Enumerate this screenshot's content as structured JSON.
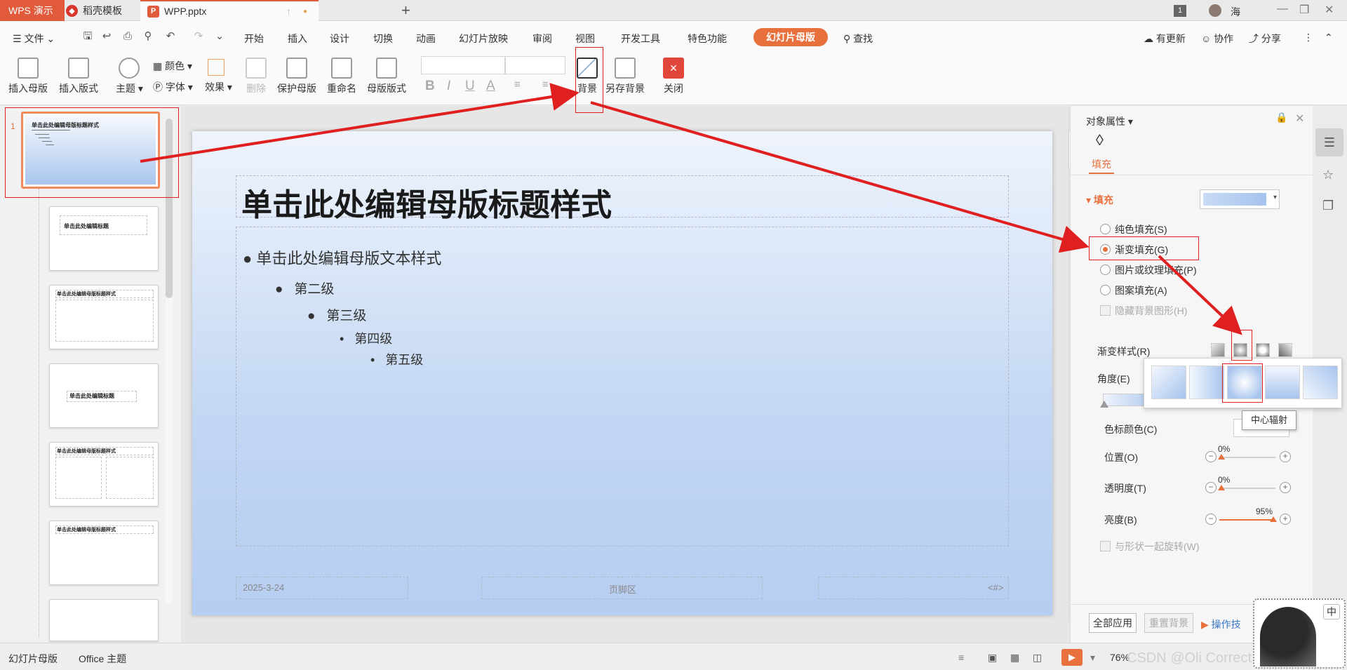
{
  "titlebar": {
    "app_name": "WPS 演示",
    "tabs": [
      {
        "label": "稻壳模板",
        "icon": "daoke-logo-icon"
      },
      {
        "label": "WPP.pptx",
        "icon": "pptx-file-icon"
      }
    ],
    "badge": "1",
    "user": "海"
  },
  "menu": {
    "file_label": "文件",
    "items": [
      "开始",
      "插入",
      "设计",
      "切换",
      "动画",
      "幻灯片放映",
      "审阅",
      "视图",
      "开发工具",
      "特色功能"
    ],
    "active_tab": "幻灯片母版",
    "search_label": "查找",
    "right": [
      "有更新",
      "协作",
      "分享"
    ]
  },
  "ribbon": {
    "insert_master": "插入母版",
    "insert_layout": "插入版式",
    "theme": "主题",
    "colors": "颜色",
    "fonts": "字体",
    "effects": "效果",
    "delete": "删除",
    "protect_master": "保护母版",
    "rename": "重命名",
    "master_layout": "母版版式",
    "background": "背景",
    "save_background": "另存背景",
    "close": "关闭",
    "fmt_bold": "B",
    "fmt_italic": "I",
    "fmt_underline": "U",
    "fmt_color": "A"
  },
  "slide_panel": {
    "slide_number": "1",
    "thumbs": [
      {
        "title": "单击此处编辑母版标题样式"
      },
      {
        "title": "单击此处编辑标题"
      },
      {
        "title": "单击此处编辑母版标题样式"
      },
      {
        "title": "单击此处编辑标题"
      },
      {
        "title": "单击此处编辑母版标题样式"
      },
      {
        "title": "单击此处编辑母版标题样式"
      }
    ]
  },
  "slide": {
    "title": "单击此处编辑母版标题样式",
    "levels": [
      "单击此处编辑母版文本样式",
      "第二级",
      "第三级",
      "第四级",
      "第五级"
    ],
    "footer_date": "2025-3-24",
    "footer_text": "页脚区",
    "footer_num": "<#>"
  },
  "properties": {
    "header": "对象属性",
    "tab": "填充",
    "section": "填充",
    "options": [
      "纯色填充(S)",
      "渐变填充(G)",
      "图片或纹理填充(P)",
      "图案填充(A)"
    ],
    "hide_bg": "隐藏背景图形(H)",
    "gradient_style": "渐变样式(R)",
    "angle": "角度(E)",
    "stop_color": "色标颜色(C)",
    "position": "位置(O)",
    "position_value": "0%",
    "transparency": "透明度(T)",
    "transparency_value": "0%",
    "brightness": "亮度(B)",
    "brightness_value": "95%",
    "rotate_with_shape": "与形状一起旋转(W)",
    "apply_all": "全部应用",
    "reset_bg": "重置背景",
    "tips": "操作技",
    "tooltip": "中心辐射",
    "brightness_level": 0.95
  },
  "statusbar": {
    "mode": "幻灯片母版",
    "theme": "Office 主题",
    "zoom": "76%",
    "watermark": "CSDN @Oli Correct",
    "ime": "中"
  },
  "colors": {
    "accent": "#e8703d",
    "red_annotation": "#e02020"
  }
}
